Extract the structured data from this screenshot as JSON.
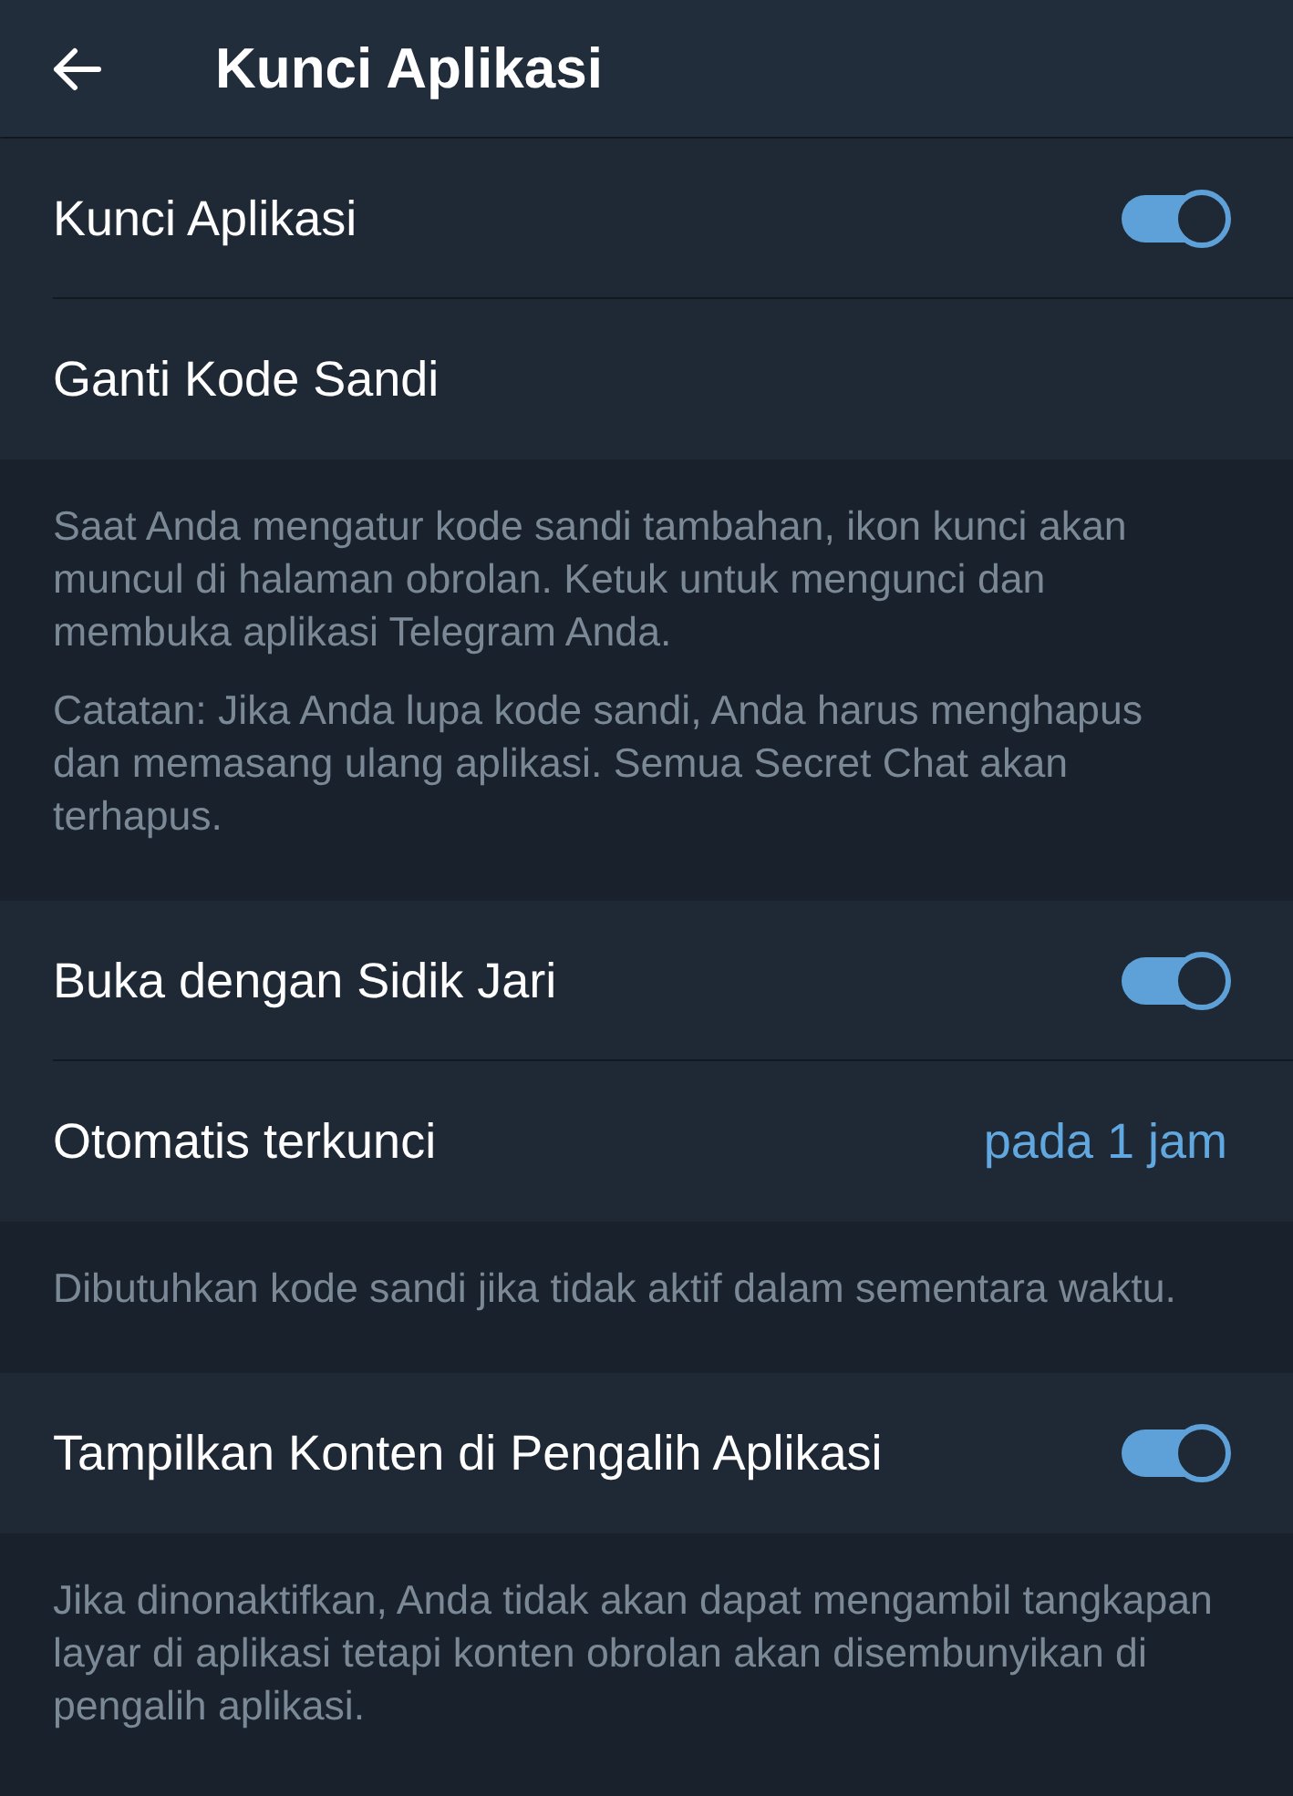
{
  "header": {
    "title": "Kunci Aplikasi"
  },
  "sections": [
    {
      "kind": "rows",
      "rows": [
        {
          "kind": "toggle",
          "label": "Kunci Aplikasi",
          "on": true
        },
        {
          "kind": "plain",
          "label": "Ganti Kode Sandi"
        }
      ]
    },
    {
      "kind": "hint",
      "paragraphs": [
        "Saat Anda mengatur kode sandi tambahan, ikon kunci akan muncul di halaman obrolan. Ketuk untuk mengunci dan membuka aplikasi Telegram Anda.",
        "Catatan: Jika Anda lupa kode sandi, Anda harus menghapus dan memasang ulang aplikasi. Semua Secret Chat akan terhapus."
      ]
    },
    {
      "kind": "rows",
      "rows": [
        {
          "kind": "toggle",
          "label": "Buka dengan Sidik Jari",
          "on": true
        },
        {
          "kind": "value",
          "label": "Otomatis terkunci",
          "value": "pada 1 jam"
        }
      ]
    },
    {
      "kind": "hint",
      "paragraphs": [
        "Dibutuhkan kode sandi jika tidak aktif dalam sementara waktu."
      ]
    },
    {
      "kind": "rows",
      "rows": [
        {
          "kind": "toggle",
          "label": "Tampilkan Konten di Pengalih Aplikasi",
          "on": true
        }
      ]
    },
    {
      "kind": "hint",
      "paragraphs": [
        "Jika dinonaktifkan, Anda tidak akan dapat mengambil tangkapan layar di aplikasi tetapi konten obrolan akan disembunyikan di pengalih aplikasi."
      ]
    }
  ]
}
